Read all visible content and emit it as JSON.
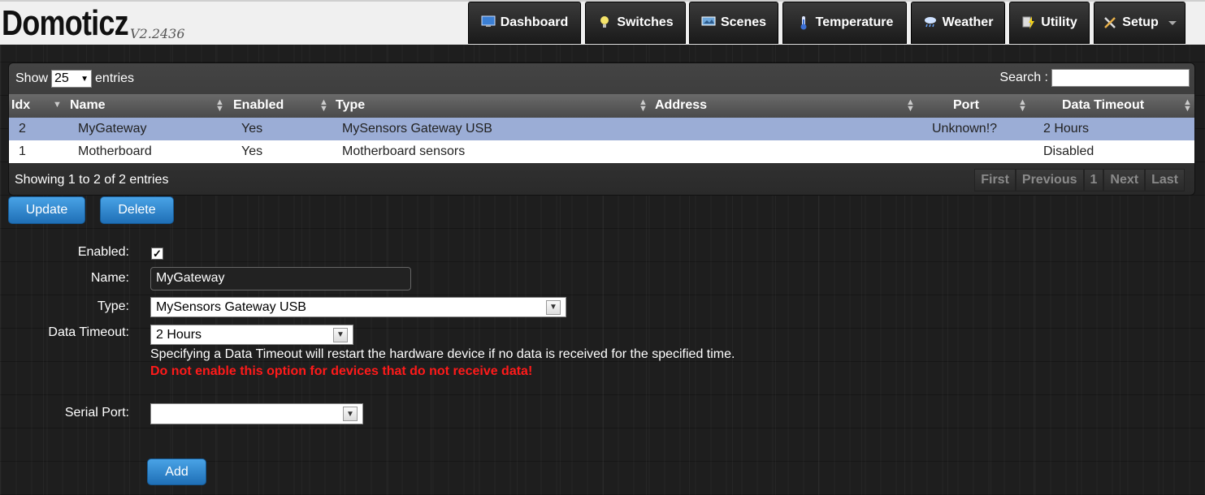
{
  "app": {
    "name": "Domoticz",
    "version": "V2.2436"
  },
  "nav": [
    {
      "label": "Dashboard",
      "icon": "monitor-icon"
    },
    {
      "label": "Switches",
      "icon": "lightbulb-icon"
    },
    {
      "label": "Scenes",
      "icon": "scenes-icon"
    },
    {
      "label": "Temperature",
      "icon": "thermometer-icon"
    },
    {
      "label": "Weather",
      "icon": "cloud-rain-icon"
    },
    {
      "label": "Utility",
      "icon": "utility-icon"
    },
    {
      "label": "Setup",
      "icon": "tools-icon"
    }
  ],
  "table": {
    "show_label": "Show",
    "entries_label": "entries",
    "page_length": "25",
    "search_label": "Search :",
    "search_value": "",
    "columns": [
      "Idx",
      "Name",
      "Enabled",
      "Type",
      "Address",
      "Port",
      "Data Timeout"
    ],
    "rows": [
      {
        "idx": "2",
        "name": "MyGateway",
        "enabled": "Yes",
        "type": "MySensors Gateway USB",
        "address": "",
        "port": "Unknown!?",
        "timeout": "2 Hours",
        "selected": true
      },
      {
        "idx": "1",
        "name": "Motherboard",
        "enabled": "Yes",
        "type": "Motherboard sensors",
        "address": "",
        "port": "",
        "timeout": "Disabled",
        "selected": false
      }
    ],
    "info": "Showing 1 to 2 of 2 entries",
    "pager": {
      "first": "First",
      "previous": "Previous",
      "page": "1",
      "next": "Next",
      "last": "Last"
    }
  },
  "actions": {
    "update": "Update",
    "delete": "Delete",
    "add": "Add"
  },
  "form": {
    "enabled_label": "Enabled:",
    "enabled": true,
    "name_label": "Name:",
    "name_value": "MyGateway",
    "type_label": "Type:",
    "type_value": "MySensors Gateway USB",
    "timeout_label": "Data Timeout:",
    "timeout_value": "2 Hours",
    "timeout_hint": "Specifying a Data Timeout will restart the hardware device if no data is received for the specified time.",
    "timeout_warning": "Do not enable this option for devices that do not receive data!",
    "serial_label": "Serial Port:",
    "serial_value": ""
  },
  "colors": {
    "selected_row": "#9badd6",
    "button_blue": "#2a86d0",
    "warning": "#ff1a1a"
  }
}
